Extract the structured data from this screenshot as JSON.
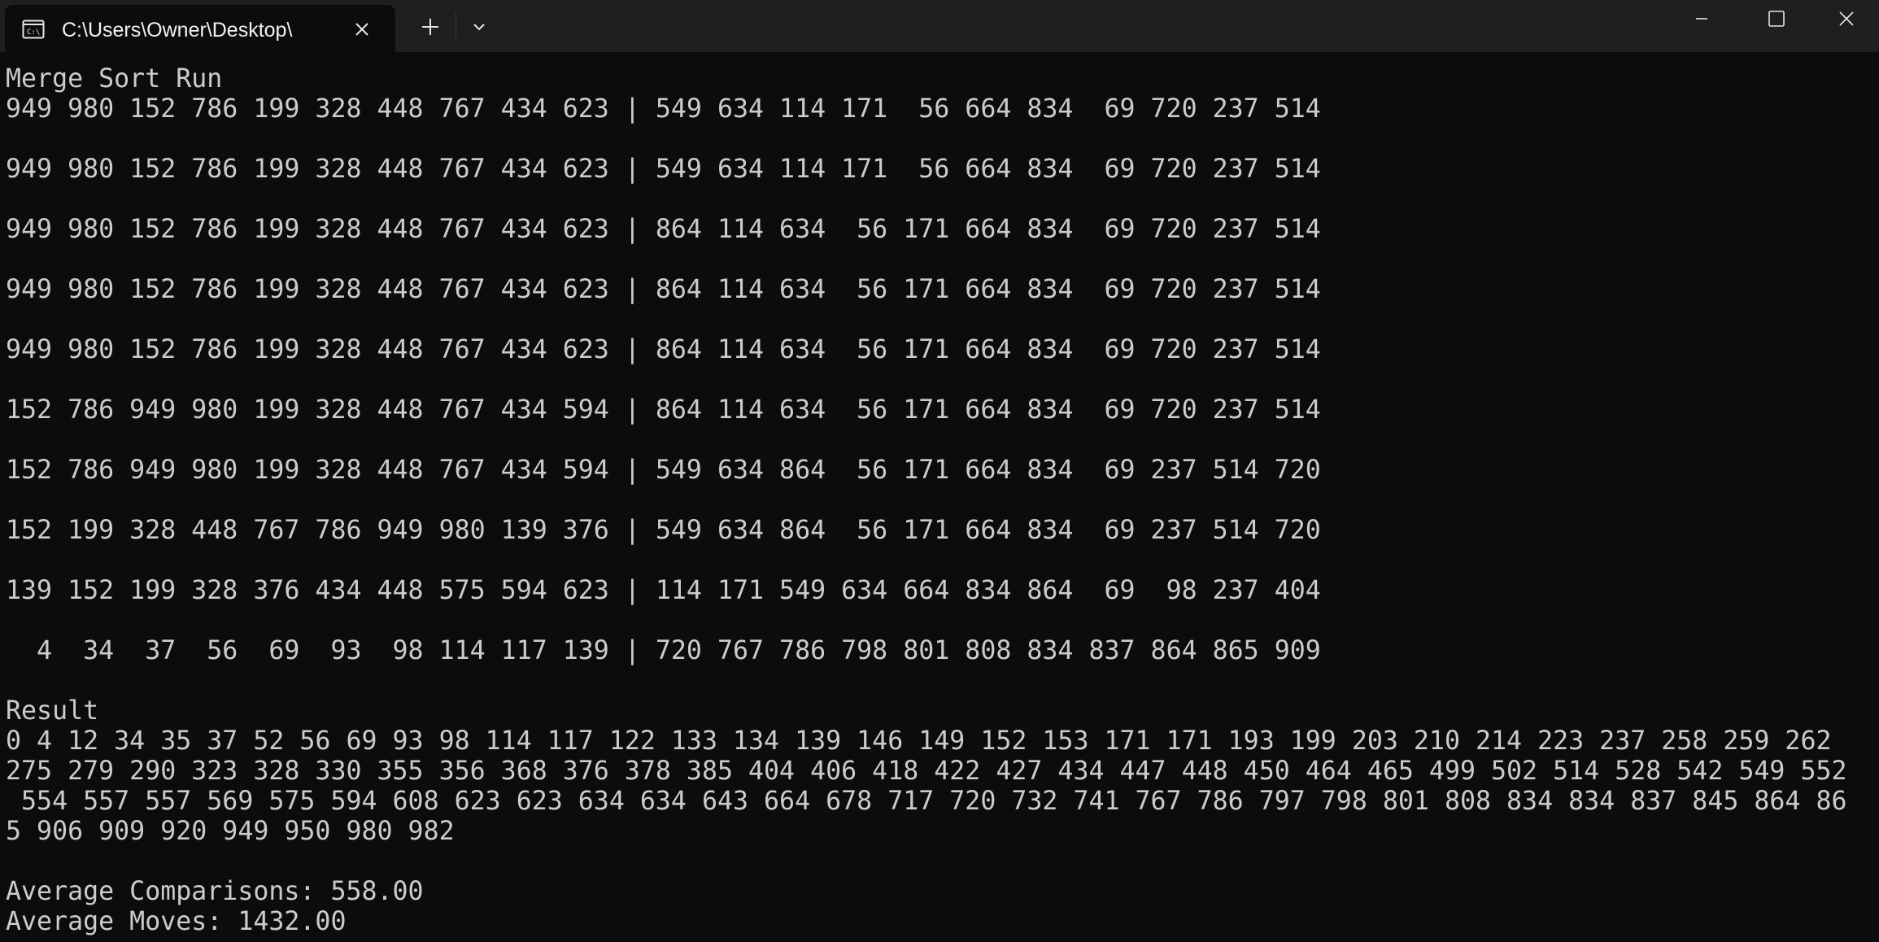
{
  "titlebar": {
    "tab_title": "C:\\Users\\Owner\\Desktop\\",
    "tab_icon": "terminal-icon",
    "close_icon": "close-icon",
    "new_tab_icon": "plus-icon",
    "dropdown_icon": "chevron-down-icon"
  },
  "window_controls": {
    "minimize_icon": "minimize-icon",
    "maximize_icon": "maximize-icon",
    "close_icon": "close-icon"
  },
  "colors": {
    "terminal_background": "#0c0c0c",
    "titlebar_background": "#1f1f1f",
    "text": "#cccccc"
  },
  "console": {
    "heading": "Merge Sort Run",
    "rows": [
      "949 980 152 786 199 328 448 767 434 623 | 549 634 114 171  56 664 834  69 720 237 514",
      "949 980 152 786 199 328 448 767 434 623 | 549 634 114 171  56 664 834  69 720 237 514",
      "949 980 152 786 199 328 448 767 434 623 | 864 114 634  56 171 664 834  69 720 237 514",
      "949 980 152 786 199 328 448 767 434 623 | 864 114 634  56 171 664 834  69 720 237 514",
      "949 980 152 786 199 328 448 767 434 623 | 864 114 634  56 171 664 834  69 720 237 514",
      "152 786 949 980 199 328 448 767 434 594 | 864 114 634  56 171 664 834  69 720 237 514",
      "152 786 949 980 199 328 448 767 434 594 | 549 634 864  56 171 664 834  69 237 514 720",
      "152 199 328 448 767 786 949 980 139 376 | 549 634 864  56 171 664 834  69 237 514 720",
      "139 152 199 328 376 434 448 575 594 623 | 114 171 549 634 664 834 864  69  98 237 404",
      "  4  34  37  56  69  93  98 114 117 139 | 720 767 786 798 801 808 834 837 864 865 909"
    ],
    "result_label": "Result",
    "result_lines": [
      "0 4 12 34 35 37 52 56 69 93 98 114 117 122 133 134 139 146 149 152 153 171 171 193 199 203 210 214 223 237 258 259 262",
      "275 279 290 323 328 330 355 356 368 376 378 385 404 406 418 422 427 434 447 448 450 464 465 499 502 514 528 542 549 552",
      " 554 557 557 569 575 594 608 623 623 634 634 643 664 678 717 720 732 741 767 786 797 798 801 808 834 834 837 845 864 86",
      "5 906 909 920 949 950 980 982"
    ],
    "avg_comparisons": "Average Comparisons: 558.00",
    "avg_moves": "Average Moves: 1432.00"
  }
}
